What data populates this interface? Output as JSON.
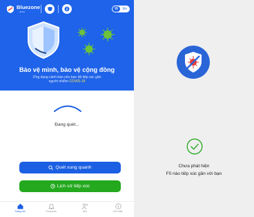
{
  "header": {
    "brand": "Bluezone",
    "brand_sub": "global",
    "lang_vi": "Vi",
    "lang_en": "En"
  },
  "hero": {
    "title": "Bảo vệ mình, bảo vệ cộng đồng",
    "subtitle_line1": "Ứng dụng cảnh báo nếu bạn đã tiếp xúc gần",
    "subtitle_line2_prefix": "người nhiễm ",
    "subtitle_highlight": "COVID-19"
  },
  "scan": {
    "status": "Đang quét..."
  },
  "buttons": {
    "scan_nearby": "Quét xung quanh",
    "contact_history": "Lịch sử tiếp xúc"
  },
  "nav": {
    "items": [
      {
        "label": "Trang chủ",
        "icon": "home-icon",
        "active": true
      },
      {
        "label": "Thông báo",
        "icon": "bell-icon",
        "active": false
      },
      {
        "label": "Mời",
        "icon": "invite-icon",
        "active": false
      },
      {
        "label": "Giới thiệu",
        "icon": "info-icon",
        "active": false
      }
    ]
  },
  "result": {
    "line1": "Chưa phát hiện",
    "line2": "F0 nào tiếp xúc gần với bạn"
  },
  "colors": {
    "primary": "#1e63e9",
    "green": "#23a81e",
    "badge": "#2a65d8",
    "virus": "#6cc23a",
    "alert": "#e53935"
  }
}
